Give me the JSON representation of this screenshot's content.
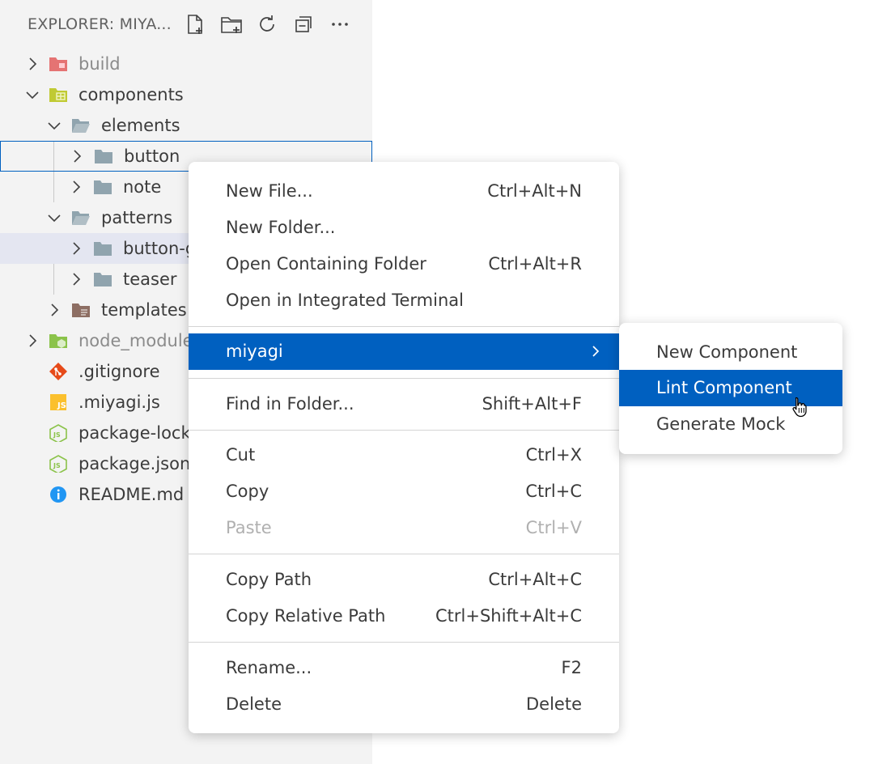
{
  "explorer": {
    "title": "EXPLORER: MIYA...",
    "actions": [
      {
        "name": "new-file-icon"
      },
      {
        "name": "new-folder-icon"
      },
      {
        "name": "refresh-icon"
      },
      {
        "name": "collapse-all-icon"
      },
      {
        "name": "more-actions-icon"
      }
    ],
    "tree": [
      {
        "label": "build",
        "expanded": false,
        "icon": "build-folder-icon"
      },
      {
        "label": "components",
        "expanded": true,
        "icon": "components-folder-icon"
      },
      {
        "label": "elements",
        "expanded": true,
        "icon": "folder-open-icon"
      },
      {
        "label": "button",
        "expanded": false,
        "icon": "folder-icon"
      },
      {
        "label": "note",
        "expanded": false,
        "icon": "folder-icon"
      },
      {
        "label": "patterns",
        "expanded": true,
        "icon": "folder-open-icon"
      },
      {
        "label": "button-g",
        "expanded": false,
        "icon": "folder-icon"
      },
      {
        "label": "teaser",
        "expanded": false,
        "icon": "folder-icon"
      },
      {
        "label": "templates",
        "expanded": false,
        "icon": "templates-folder-icon"
      },
      {
        "label": "node_module",
        "expanded": false,
        "icon": "node-modules-folder-icon"
      },
      {
        "label": ".gitignore",
        "icon": "git-icon"
      },
      {
        "label": ".miyagi.js",
        "icon": "js-file-icon"
      },
      {
        "label": "package-lock.",
        "icon": "nodejs-icon"
      },
      {
        "label": "package.json",
        "icon": "nodejs-icon"
      },
      {
        "label": "README.md",
        "icon": "info-icon"
      }
    ]
  },
  "context_menu": {
    "items": [
      {
        "label": "New File...",
        "shortcut": "Ctrl+Alt+N"
      },
      {
        "label": "New Folder...",
        "shortcut": ""
      },
      {
        "label": "Open Containing Folder",
        "shortcut": "Ctrl+Alt+R"
      },
      {
        "label": "Open in Integrated Terminal",
        "shortcut": ""
      },
      {
        "label": "miyagi",
        "shortcut": ""
      },
      {
        "label": "Find in Folder...",
        "shortcut": "Shift+Alt+F"
      },
      {
        "label": "Cut",
        "shortcut": "Ctrl+X"
      },
      {
        "label": "Copy",
        "shortcut": "Ctrl+C"
      },
      {
        "label": "Paste",
        "shortcut": "Ctrl+V"
      },
      {
        "label": "Copy Path",
        "shortcut": "Ctrl+Alt+C"
      },
      {
        "label": "Copy Relative Path",
        "shortcut": "Ctrl+Shift+Alt+C"
      },
      {
        "label": "Rename...",
        "shortcut": "F2"
      },
      {
        "label": "Delete",
        "shortcut": "Delete"
      }
    ]
  },
  "submenu": {
    "items": [
      {
        "label": "New Component"
      },
      {
        "label": "Lint Component"
      },
      {
        "label": "Generate Mock"
      }
    ]
  },
  "colors": {
    "accent": "#0060c0",
    "sidebar_bg": "#f3f3f3",
    "selection_bg": "#e4e6f1"
  }
}
